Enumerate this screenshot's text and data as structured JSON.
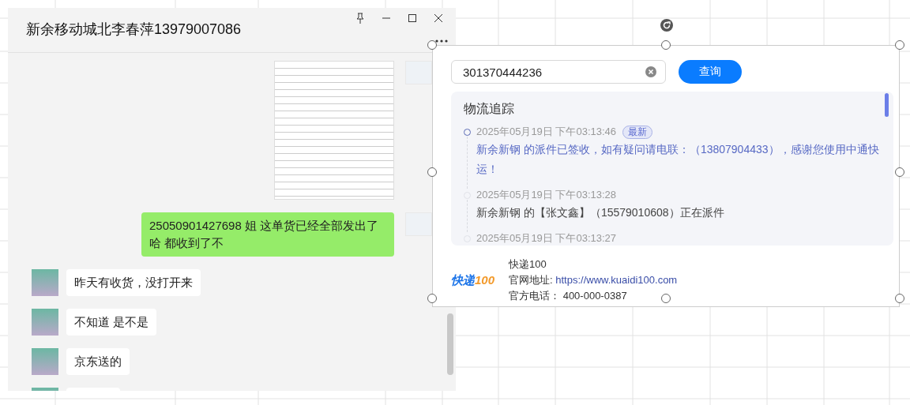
{
  "chat_window": {
    "title": "新余移动城北李春萍13979007086",
    "messages": [
      {
        "outgoing": true,
        "kind": "image"
      },
      {
        "outgoing": true,
        "kind": "text",
        "text": "25050901427698  姐 这单货已经全部发出了哈 都收到了不"
      },
      {
        "outgoing": false,
        "kind": "text",
        "text": "昨天有收货，没打开来"
      },
      {
        "outgoing": false,
        "kind": "text",
        "text": "不知道 是不是"
      },
      {
        "outgoing": false,
        "kind": "text",
        "text": "京东送的"
      },
      {
        "outgoing": false,
        "kind": "cut"
      }
    ]
  },
  "tracking_card": {
    "search": {
      "value": "301370444236"
    },
    "query_button": "查询",
    "panel": {
      "title": "物流追踪",
      "events": [
        {
          "time": "2025年05月19日 下午03:13:46",
          "badge": "最新",
          "current": true,
          "text": "新余新钢 的派件已签收，如有疑问请电联：（13807904433），感谢您使用中通快运！"
        },
        {
          "time": "2025年05月19日 下午03:13:28",
          "current": false,
          "text": "新余新钢 的【张文鑫】（15579010608）正在派件"
        },
        {
          "time": "2025年05月19日 下午03:13:27",
          "current": false
        }
      ]
    },
    "footer": {
      "logo_text": "快递",
      "logo_number": "100",
      "company": "快递100",
      "website_label": "官网地址:",
      "website": "https://www.kuaidi100.com",
      "phone_label": "官方电话：",
      "phone": "400-000-0387"
    }
  }
}
